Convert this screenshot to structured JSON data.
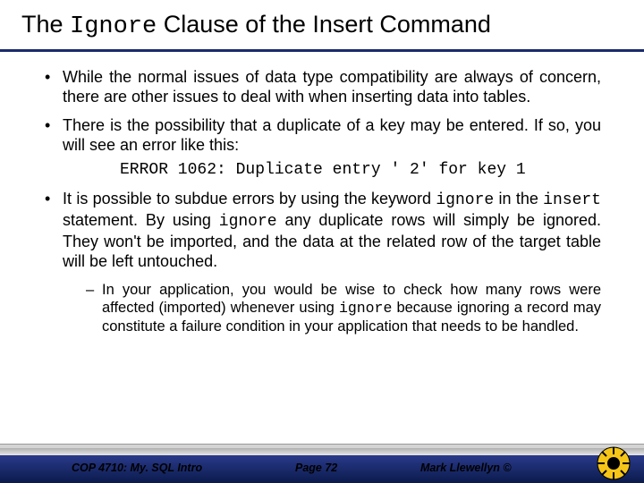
{
  "title": {
    "pre": "The ",
    "code": "Ignore",
    "post": " Clause of the Insert Command"
  },
  "bullets": {
    "b1": "While the normal issues of data type compatibility are always of concern, there are other issues to deal with when inserting data into tables.",
    "b2": "There is the possibility that a duplicate of a key may be entered.  If so, you will see an error like this:",
    "error": "ERROR 1062: Duplicate entry ' 2' for key 1",
    "b3_1": "It is possible to subdue errors by using the keyword ",
    "b3_c1": "ignore",
    "b3_2": " in the ",
    "b3_c2": "insert",
    "b3_3": "  statement.  By using ",
    "b3_c3": "ignore",
    "b3_4": " any duplicate rows will simply be ignored.  They won't be imported, and the data at the related row of the target table will be left untouched.",
    "sub_1": "In your application, you would be wise to check how many rows were affected (imported) whenever using ",
    "sub_c": "ignore",
    "sub_2": "  because ignoring a record may constitute a failure condition in your application that needs to be handled."
  },
  "footer": {
    "left": "COP 4710: My. SQL Intro",
    "center": "Page 72",
    "right": "Mark Llewellyn ©"
  }
}
